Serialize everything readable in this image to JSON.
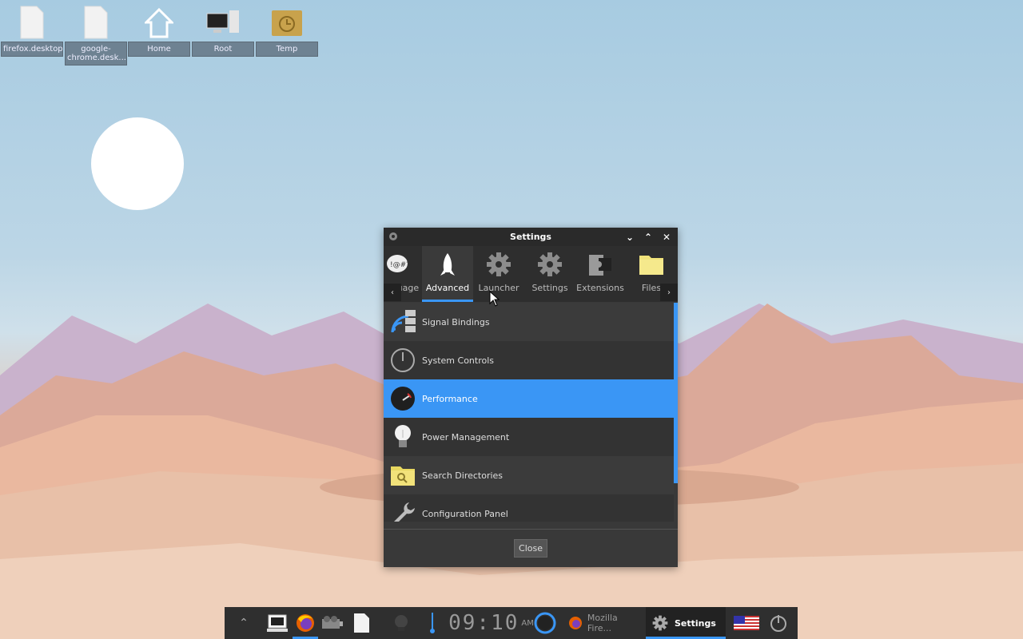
{
  "desktop": {
    "icons": [
      {
        "label": "firefox.desktop",
        "icon": "file-icon"
      },
      {
        "label": "google-chrome.desk...",
        "icon": "file-icon"
      },
      {
        "label": "Home",
        "icon": "home-icon"
      },
      {
        "label": "Root",
        "icon": "computer-icon"
      },
      {
        "label": "Temp",
        "icon": "clock-folder-icon"
      }
    ]
  },
  "window": {
    "title": "Settings",
    "tabs": [
      {
        "label": "Language",
        "icon": "language-icon"
      },
      {
        "label": "Advanced",
        "icon": "rocket-icon",
        "active": true
      },
      {
        "label": "Launcher",
        "icon": "gear-icon"
      },
      {
        "label": "Settings",
        "icon": "gear-icon"
      },
      {
        "label": "Extensions",
        "icon": "puzzle-icon"
      },
      {
        "label": "Files",
        "icon": "folder-icon"
      }
    ],
    "items": [
      {
        "label": "Signal Bindings",
        "icon": "signal-icon"
      },
      {
        "label": "System Controls",
        "icon": "power-icon"
      },
      {
        "label": "Performance",
        "icon": "gauge-icon",
        "selected": true
      },
      {
        "label": "Power Management",
        "icon": "bulb-icon"
      },
      {
        "label": "Search Directories",
        "icon": "folder-search-icon"
      },
      {
        "label": "Configuration Panel",
        "icon": "wrench-icon"
      }
    ],
    "close_label": "Close"
  },
  "taskbar": {
    "clock": "09:10",
    "ampm": "AM",
    "firefox_task": "Mozilla Fire...",
    "settings_task": "Settings",
    "accent": "#3a96f5"
  }
}
